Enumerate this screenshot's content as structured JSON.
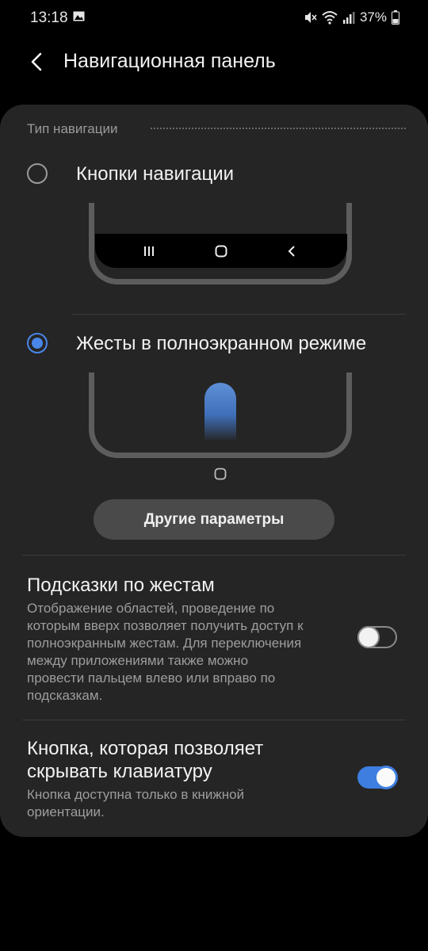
{
  "status_bar": {
    "time": "13:18",
    "battery": "37%",
    "icons": [
      "photo-icon",
      "mute-icon",
      "wifi-icon",
      "signal-icon",
      "battery-icon"
    ]
  },
  "header": {
    "title": "Навигационная панель",
    "back_icon": "back-arrow-icon"
  },
  "navigation_type": {
    "section_title": "Тип навигации",
    "options": [
      {
        "label": "Кнопки навигации",
        "selected": false
      },
      {
        "label": "Жесты в полноэкранном режиме",
        "selected": true
      }
    ],
    "preview_icons": [
      "recents-icon",
      "home-icon",
      "back-icon"
    ]
  },
  "other_params_button": "Другие параметры",
  "gesture_hints": {
    "title": "Подсказки по жестам",
    "desc_lines": [
      "Отображение областей, проведение по",
      "которым вверх позволяет получить доступ к",
      "полноэкранным жестам. Для переключения",
      "между приложениями также можно",
      "провести пальцем влево или вправо по",
      "подсказкам."
    ],
    "enabled": false
  },
  "keyboard_button": {
    "title_lines": [
      "Кнопка, которая позволяет",
      "скрывать клавиатуру"
    ],
    "desc_lines": [
      "Кнопка доступна только в книжной",
      "ориентации."
    ],
    "enabled": true
  },
  "colors": {
    "accent": "#4a86e8",
    "card_background": "#252525",
    "page_background": "#000000"
  }
}
